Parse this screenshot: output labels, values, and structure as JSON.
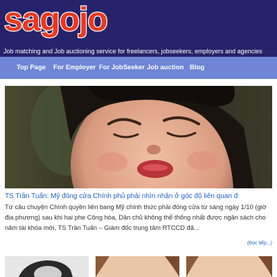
{
  "header": {
    "logo_text": "sagojo",
    "tagline": "Job matching and Job auctioning service for freelancers, jobseekers, employers and agencies"
  },
  "nav": {
    "items": [
      {
        "label": "Top Page"
      },
      {
        "label": "For Employer"
      },
      {
        "label": "For JobSeeker"
      },
      {
        "label": "Job auction"
      },
      {
        "label": "Blog"
      }
    ]
  },
  "featured": {
    "title": "TS Trần Tuấn: Mỹ đóng cửa Chính phủ phải nhìn nhận ở góc độ liên quan đ",
    "excerpt": "Từ câu chuyện Chính quyền liên bang Mỹ chính thức phải đóng cửa từ sáng ngày 1/10 (giờ địa phương) sau khi hai phe Cộng hòa, Dân chủ không thể thống nhất được ngân sách cho năm tài khóa mới, TS Trần Tuấn – Giám đốc trung tâm RTCCD đã...",
    "read_more": "(Đọc tiếp...)"
  },
  "colors": {
    "header_bg": "#26236b",
    "logo": "#e8391f",
    "nav_bg": "#6f86d6",
    "link": "#1e63c4"
  }
}
